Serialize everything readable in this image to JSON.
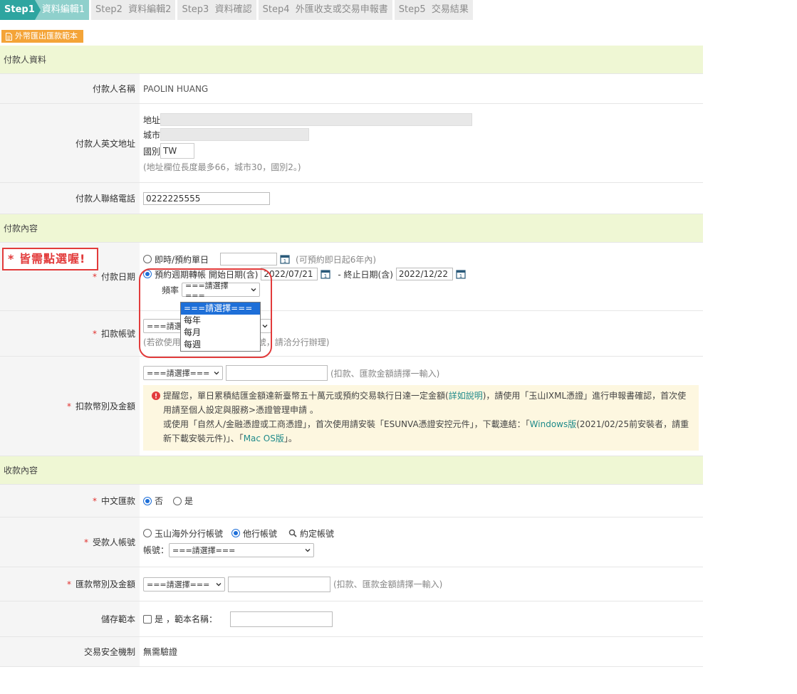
{
  "steps": [
    {
      "num": "Step1",
      "label": "資料編輯1"
    },
    {
      "num": "Step2",
      "label": "資料編輯2"
    },
    {
      "num": "Step3",
      "label": "資料確認"
    },
    {
      "num": "Step4",
      "label": "外匯收支或交易申報書"
    },
    {
      "num": "Step5",
      "label": "交易結果"
    }
  ],
  "sample_button": "外幣匯出匯款範本",
  "payer_section": {
    "title": "付款人資料",
    "name_label": "付款人名稱",
    "name_value": "PAOLIN HUANG",
    "address_label": "付款人英文地址",
    "addr_field_label": "地址",
    "addr_value": "",
    "city_field_label": "城市",
    "city_value": "",
    "country_field_label": "國別",
    "country_value": "TW",
    "addr_hint": "(地址欄位長度最多66，城市30，國別2。)",
    "phone_label": "付款人聯絡電話",
    "phone_value": "0222225555"
  },
  "payment_section": {
    "title": "付款內容",
    "date_label": "付款日期",
    "date_option_single": "即時/預約單日",
    "date_single_hint": "(可預約即日起6年內)",
    "date_option_periodic": "預約週期轉帳",
    "start_label": "開始日期(含)",
    "start_value": "2022/07/21",
    "end_label": "- 終止日期(含)",
    "end_value": "2022/12/22",
    "freq_label": "頻率",
    "freq_selected": "===請選擇===",
    "freq_options": [
      "===請選擇===",
      "每年",
      "每月",
      "每週"
    ],
    "debit_label": "扣款帳號",
    "debit_selected": "===請選",
    "debit_hint_a": "(若欲使用",
    "debit_hint_b": "帳號，請洽分行辦理)",
    "currency_label": "扣款幣別及金額",
    "currency_selected": "===請選擇===",
    "currency_hint": "(扣款、匯款金額請擇一輸入)",
    "warn_line1a": "提醒您，單日累積結匯金額達新臺幣五十萬元或預約交易執行日達一定金額(",
    "warn_link1": "詳如說明",
    "warn_line1b": ")，請使用「玉山IXML憑證」進行申報書確認，首次使用請至個人設定與服務>憑證管理申請 。",
    "warn_line2a": "或使用「自然人/金融憑證或工商憑證」，首次使用請安裝「ESUNVA憑證安控元件」，下載連結：「",
    "warn_link2": "Windows版",
    "warn_line2b": "(2021/02/25前安裝者，請重新下載安裝元件)」、「",
    "warn_link3": "Mac OS版",
    "warn_line2c": "」。"
  },
  "receive_section": {
    "title": "收款內容",
    "chinese_label": "中文匯款",
    "chinese_no": "否",
    "chinese_yes": "是",
    "payee_label": "受款人帳號",
    "payee_opt1": "玉山海外分行帳號",
    "payee_opt2": "他行帳號",
    "payee_agreed": "約定帳號",
    "account_label": "帳號：",
    "account_selected": "===請選擇===",
    "remit_label": "匯款幣別及金額",
    "remit_selected": "===請選擇===",
    "remit_hint": "(扣款、匯款金額請擇一輸入)",
    "save_label": "儲存範本",
    "save_yes": "是",
    "template_name_label": "，範本名稱：",
    "security_label": "交易安全機制",
    "security_value": "無需驗證"
  },
  "annotation": "* 皆需點選喔!",
  "colors": {
    "accent": "#2ea5a0",
    "section_bg": "#eff7d4",
    "warn": "#e23b3b",
    "orange": "#f4a438"
  }
}
